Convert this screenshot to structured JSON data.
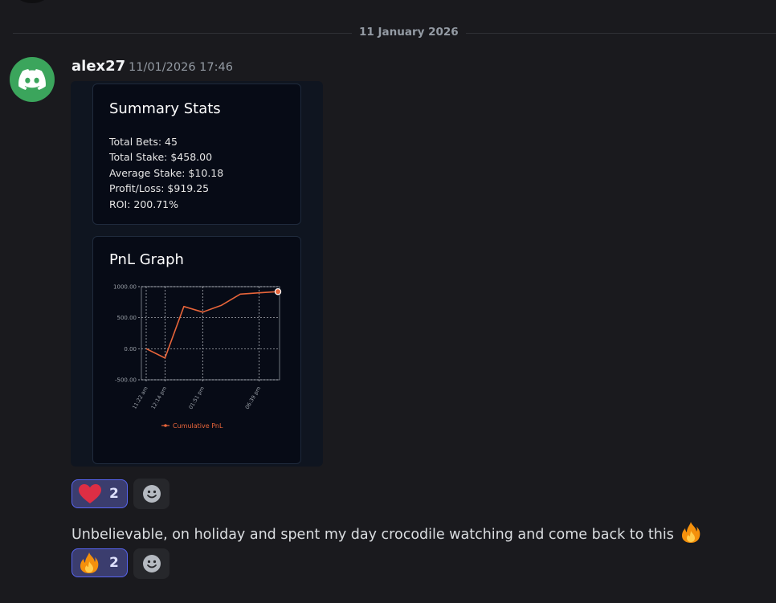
{
  "previous_message": {
    "text": ""
  },
  "date_divider": "11 January 2026",
  "message": {
    "author": "alex27",
    "timestamp": "11/01/2026 17:46",
    "avatar_icon": "discord-logo-icon",
    "avatar_color": "#3ba55c",
    "text": "Unbelievable, on holiday and spent my day crocodile watching and come back to this",
    "text_emoji": "fire-emoji"
  },
  "attachment": {
    "summary": {
      "title": "Summary Stats",
      "lines": [
        "Total Bets: 45",
        "Total Stake: $458.00",
        "Average Stake: $10.18",
        "Profit/Loss: $919.25",
        "ROI: 200.71%"
      ]
    },
    "graph": {
      "title": "PnL Graph"
    }
  },
  "chart_data": {
    "type": "line",
    "title": "",
    "x": [
      "11:22 am",
      "12:14 pm",
      "12:20 pm",
      "01:51 pm",
      "02:30 pm",
      "03:30 pm",
      "06:39 pm",
      "06:42 pm"
    ],
    "xticks": [
      "11:22 am",
      "12:14 pm",
      "01:51 pm",
      "06:39 pm"
    ],
    "series": [
      {
        "name": "Cumulative PnL",
        "color": "#e8653a",
        "values": [
          0,
          -150,
          680,
          590,
          700,
          880,
          900,
          919.25
        ]
      }
    ],
    "yticks": [
      "1000.00",
      "500.00",
      "0.00",
      "-500.00"
    ],
    "ylim": [
      -500,
      1000
    ],
    "grid": true,
    "legend": "bottom"
  },
  "reactions_image": {
    "emoji": "red-heart-emoji",
    "count": "2",
    "add_icon": "add-reaction-smiley-icon"
  },
  "reactions_text": {
    "emoji": "fire-emoji",
    "count": "2",
    "add_icon": "add-reaction-smiley-icon"
  },
  "colors": {
    "background": "#1a1a1e",
    "reaction_active_bg": "#3b3d6e",
    "reaction_active_border": "#5865f2",
    "pnl_line": "#e8653a"
  }
}
